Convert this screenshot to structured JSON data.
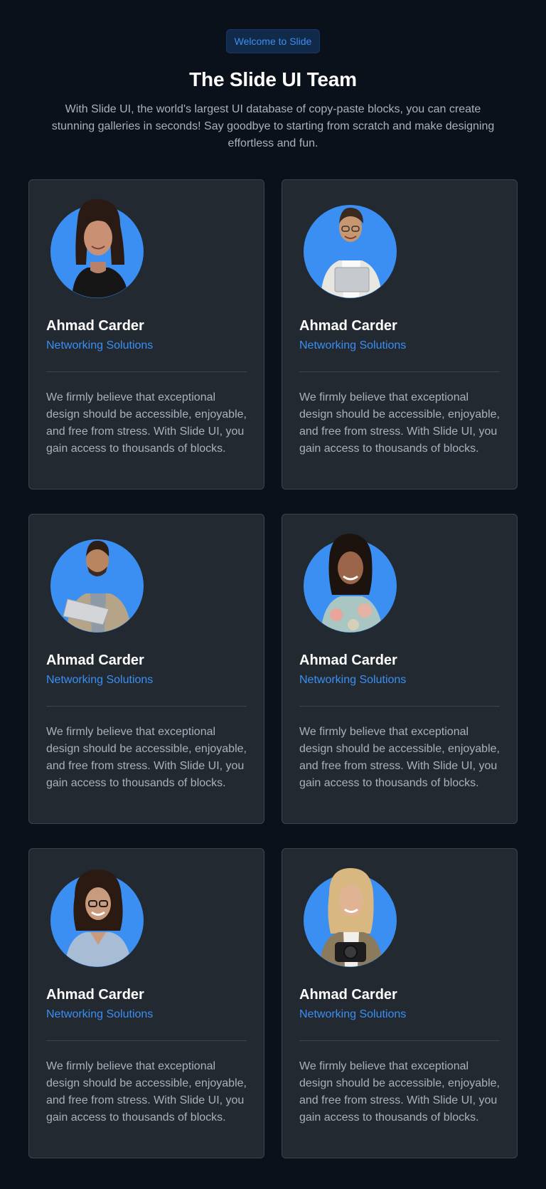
{
  "header": {
    "badge": "Welcome to Slide",
    "title": "The Slide UI Team",
    "subtitle": "With Slide UI, the world's largest UI database of copy-paste blocks, you can create stunning galleries in seconds! Say goodbye to starting from scratch and make designing effortless and fun."
  },
  "colors": {
    "background": "#0b111b",
    "card": "#222931",
    "accent": "#3b8ff2",
    "text_primary": "#ffffff",
    "text_muted": "#aab1bd"
  },
  "team": [
    {
      "name": "Ahmad Carder",
      "role": "Networking Solutions",
      "bio": "We firmly believe that exceptional design should be accessible, enjoyable, and free from stress. With Slide UI, you gain access to thousands of blocks.",
      "avatar": "woman-dark-shirt-portrait"
    },
    {
      "name": "Ahmad Carder",
      "role": "Networking Solutions",
      "bio": "We firmly believe that exceptional design should be accessible, enjoyable, and free from stress. With Slide UI, you gain access to thousands of blocks.",
      "avatar": "man-glasses-laptop-portrait"
    },
    {
      "name": "Ahmad Carder",
      "role": "Networking Solutions",
      "bio": "We firmly believe that exceptional design should be accessible, enjoyable, and free from stress. With Slide UI, you gain access to thousands of blocks.",
      "avatar": "man-jacket-laptop-portrait"
    },
    {
      "name": "Ahmad Carder",
      "role": "Networking Solutions",
      "bio": "We firmly believe that exceptional design should be accessible, enjoyable, and free from stress. With Slide UI, you gain access to thousands of blocks.",
      "avatar": "woman-floral-shirt-portrait"
    },
    {
      "name": "Ahmad Carder",
      "role": "Networking Solutions",
      "bio": "We firmly believe that exceptional design should be accessible, enjoyable, and free from stress. With Slide UI, you gain access to thousands of blocks.",
      "avatar": "woman-glasses-blouse-portrait"
    },
    {
      "name": "Ahmad Carder",
      "role": "Networking Solutions",
      "bio": "We firmly believe that exceptional design should be accessible, enjoyable, and free from stress. With Slide UI, you gain access to thousands of blocks.",
      "avatar": "woman-camera-portrait"
    }
  ]
}
